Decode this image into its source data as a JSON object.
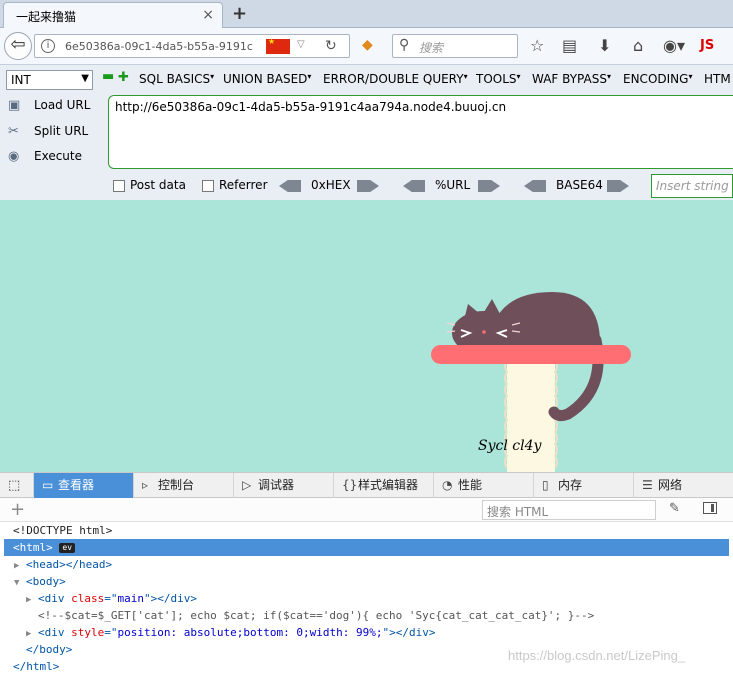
{
  "browser": {
    "tab_title": "一起来撸猫",
    "tab_close": "×",
    "new_tab": "+",
    "url_display": "6e50386a-09c1-4da5-b55a-9191c",
    "search_placeholder": "搜索",
    "js_label": "JS"
  },
  "hackbar": {
    "select_value": "INT",
    "menus": [
      "SQL BASICS",
      "UNION BASED",
      "ERROR/DOUBLE QUERY",
      "TOOLS",
      "WAF BYPASS",
      "ENCODING",
      "HTM"
    ],
    "actions": [
      "Load URL",
      "Split URL",
      "Execute"
    ],
    "url_value": "http://6e50386a-09c1-4da5-b55a-9191c4aa794a.node4.buuoj.cn",
    "post_data_label": "Post data",
    "referrer_label": "Referrer",
    "encodings": [
      "0xHEX",
      "%URL",
      "BASE64"
    ],
    "insert_placeholder": "Insert string t"
  },
  "page": {
    "signature": "Sycl        cl4y",
    "bg_color": "#abe5d9"
  },
  "devtools": {
    "tabs": [
      {
        "label": "查看器",
        "icon": "inspector-icon"
      },
      {
        "label": "控制台",
        "icon": "console-icon"
      },
      {
        "label": "调试器",
        "icon": "debugger-icon"
      },
      {
        "label": "样式编辑器",
        "icon": "style-editor-icon"
      },
      {
        "label": "性能",
        "icon": "performance-icon"
      },
      {
        "label": "内存",
        "icon": "memory-icon"
      },
      {
        "label": "网络",
        "icon": "network-icon"
      }
    ],
    "active_tab": "查看器",
    "search_placeholder": "搜索 HTML",
    "markup": {
      "doctype": "<!DOCTYPE html>",
      "html_open": "<html>",
      "ev_badge": "ev",
      "head": "<head></head>",
      "body_open": "<body>",
      "div_main_tag": "div",
      "div_main_attr": "class",
      "div_main_val": "main",
      "comment": "<!--$cat=$_GET['cat']; echo $cat; if($cat=='dog'){ echo 'Syc{cat_cat_cat_cat}'; }-->",
      "div_style_tag": "div",
      "div_style_attr": "style",
      "div_style_val": "position: absolute;bottom: 0;width: 99%;",
      "body_close": "</body>",
      "html_close": "</html>"
    }
  },
  "watermark": "https://blog.csdn.net/LizePing_"
}
